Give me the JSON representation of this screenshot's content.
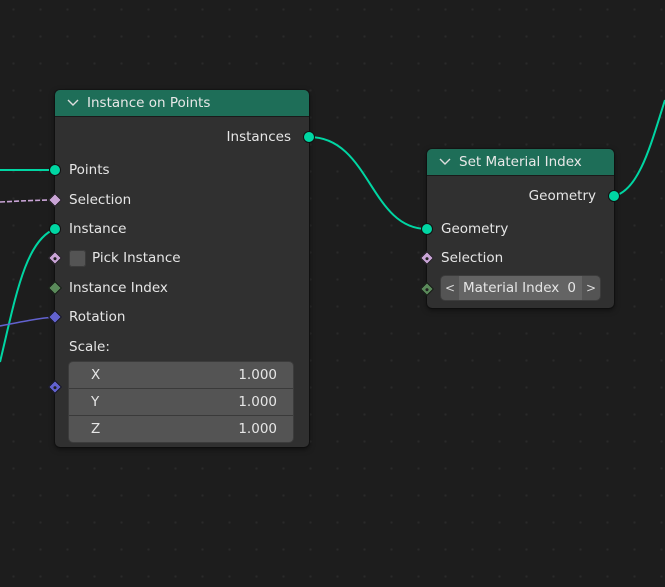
{
  "colors": {
    "geometry_socket": "#00d6a3",
    "field_socket": "#c9a4d6",
    "int_socket": "#5a8a5a",
    "vector_socket": "#6262cf",
    "header": "#1e6e58",
    "node_body": "#303030",
    "background": "#1d1d1d"
  },
  "nodes": {
    "instance_on_points": {
      "title": "Instance on Points",
      "collapse_icon": "chevron-down-icon",
      "outputs": [
        {
          "label": "Instances",
          "type": "geometry"
        }
      ],
      "inputs": {
        "points": "Points",
        "selection": "Selection",
        "instance": "Instance",
        "pick_instance": "Pick Instance",
        "instance_index": "Instance Index",
        "rotation": "Rotation",
        "scale_label": "Scale:"
      },
      "pick_instance_checked": false,
      "scale": [
        {
          "axis": "X",
          "value": "1.000"
        },
        {
          "axis": "Y",
          "value": "1.000"
        },
        {
          "axis": "Z",
          "value": "1.000"
        }
      ]
    },
    "set_material_index": {
      "title": "Set Material Index",
      "collapse_icon": "chevron-down-icon",
      "outputs": [
        {
          "label": "Geometry",
          "type": "geometry"
        }
      ],
      "inputs": {
        "geometry": "Geometry",
        "selection": "Selection",
        "material_index_label": "Material Index",
        "material_index_value": "0"
      },
      "decrement": "<",
      "increment": ">"
    }
  },
  "icons": {
    "chevron": "⌵"
  }
}
